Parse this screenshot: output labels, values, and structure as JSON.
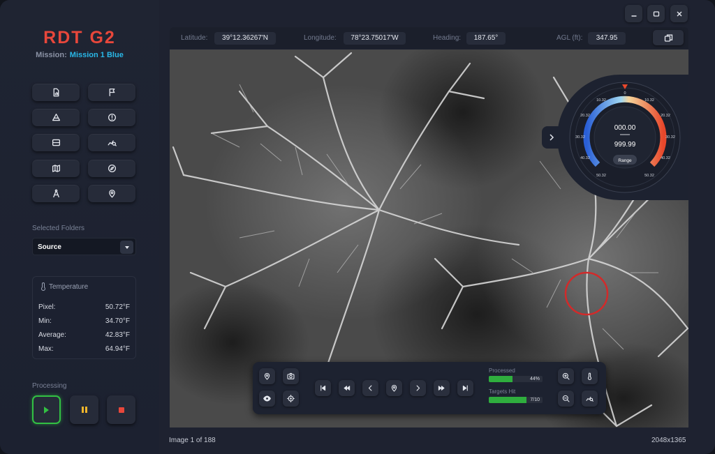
{
  "app": {
    "title": "RDT G2",
    "mission_label": "Mission:",
    "mission_value": "Mission 1 Blue"
  },
  "tools": [
    "file-chart-icon",
    "flag-icon",
    "measure-triangle-icon",
    "alert-icon",
    "scanner-icon",
    "analyze-icon",
    "map-icon",
    "compass-icon",
    "drafting-compass-icon",
    "location-pin-icon"
  ],
  "folders": {
    "section_label": "Selected Folders",
    "selected": "Source"
  },
  "temperature": {
    "title": "Temperature",
    "rows": [
      {
        "label": "Pixel:",
        "value": "50.72°F"
      },
      {
        "label": "Min:",
        "value": "34.70°F"
      },
      {
        "label": "Average:",
        "value": "42.83°F"
      },
      {
        "label": "Max:",
        "value": "64.94°F"
      }
    ]
  },
  "processing": {
    "section_label": "Processing"
  },
  "telemetry": {
    "lat_label": "Latitude:",
    "lat": "39°12.36267'N",
    "lon_label": "Longitude:",
    "lon": "78°23.75017'W",
    "heading_label": "Heading:",
    "heading": "187.65°",
    "agl_label": "AGL (ft):",
    "agl": "347.95"
  },
  "gauge": {
    "top": "000.00",
    "bottom": "999.99",
    "range_label": "Range",
    "ticks": [
      "0",
      "10.32",
      "20.32",
      "30.32",
      "40.32",
      "50.32",
      "10.32",
      "20.32",
      "30.32",
      "40.32",
      "50.32"
    ]
  },
  "controls": {
    "processed_label": "Processed",
    "processed_value": "44%",
    "processed_fraction": 0.44,
    "targets_label": "Targets Hit",
    "targets_value": "7/10",
    "targets_fraction": 0.7
  },
  "footer": {
    "image_index": "Image 1 of 188",
    "resolution": "2048x1365"
  },
  "colors": {
    "accent_red": "#e8473b",
    "accent_blue": "#29b8e8",
    "success": "#32c043",
    "warning": "#f2b62b"
  }
}
